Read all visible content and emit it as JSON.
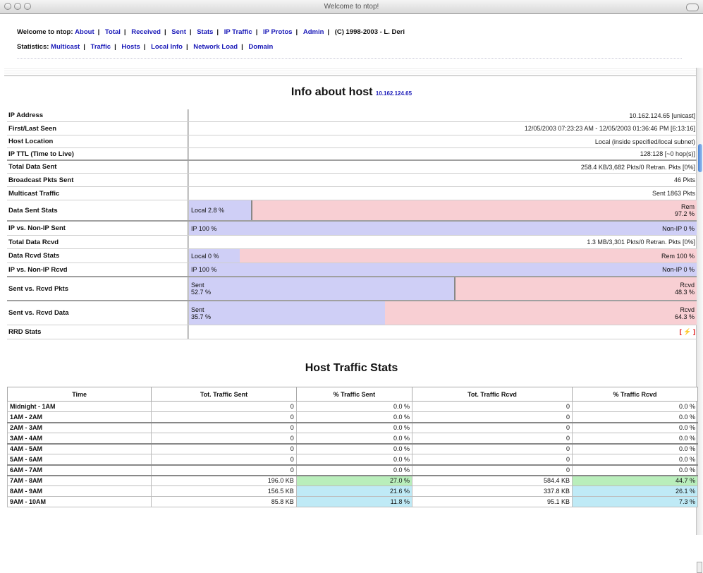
{
  "window": {
    "title": "Welcome to ntop!"
  },
  "nav1": {
    "intro": "Welcome to ntop:",
    "links": [
      "About",
      "Total",
      "Received",
      "Sent",
      "Stats",
      "IP Traffic",
      "IP Protos",
      "Admin"
    ],
    "copyright": "(C) 1998-2003 - L. Deri"
  },
  "nav2": {
    "intro": "Statistics:",
    "links": [
      "Multicast",
      "Traffic",
      "Hosts",
      "Local Info",
      "Network Load",
      "Domain"
    ]
  },
  "heading": {
    "title": "Info about host",
    "ip": "10.162.124.65"
  },
  "info": {
    "ip_address": {
      "label": "IP Address",
      "value": "10.162.124.65  [unicast]"
    },
    "first_last_seen": {
      "label": "First/Last Seen",
      "value": "12/05/2003 07:23:23 AM  -  12/05/2003 01:36:46 PM [6:13:16]"
    },
    "host_location": {
      "label": "Host Location",
      "value": "Local (inside specified/local subnet)"
    },
    "ip_ttl": {
      "label": "IP TTL (Time to Live)",
      "value": "128:128 [~0 hop(s)]"
    },
    "total_data_sent": {
      "label": "Total Data Sent",
      "value": "258.4 KB/3,682 Pkts/0 Retran. Pkts [0%]"
    },
    "broadcast_pkts": {
      "label": "Broadcast Pkts Sent",
      "value": "46 Pkts"
    },
    "multicast": {
      "label": "Multicast Traffic",
      "value": "Sent 1863 Pkts"
    },
    "data_sent_stats": {
      "label": "Data Sent Stats",
      "left": "Local 2.8 %",
      "right": "Rem\n97.2 %",
      "pct": 2.8
    },
    "ip_vs_nonip_sent": {
      "label": "IP vs. Non-IP Sent",
      "left": "IP 100 %",
      "right": "Non-IP 0 %",
      "pct": 100
    },
    "total_data_rcvd": {
      "label": "Total Data Rcvd",
      "value": "1.3 MB/3,301 Pkts/0 Retran. Pkts [0%]"
    },
    "data_rcvd_stats": {
      "label": "Data Rcvd Stats",
      "left": "Local 0 %",
      "right": "Rem 100 %",
      "pct": 0
    },
    "ip_vs_nonip_rcvd": {
      "label": "IP vs. Non-IP Rcvd",
      "left": "IP 100 %",
      "right": "Non-IP 0 %",
      "pct": 100
    },
    "sent_vs_rcvd_pkts": {
      "label": "Sent vs. Rcvd Pkts",
      "left": "Sent\n52.7 %",
      "right": "Rcvd\n48.3 %",
      "pct": 52.7
    },
    "sent_vs_rcvd_data": {
      "label": "Sent vs. Rcvd Data",
      "left": "Sent\n35.7 %",
      "right": "Rcvd\n64.3 %",
      "pct": 35.7
    },
    "rrd_stats": {
      "label": "RRD Stats",
      "value": "[ ⚡ ]"
    }
  },
  "traffic": {
    "title": "Host Traffic Stats",
    "headers": [
      "Time",
      "Tot. Traffic Sent",
      "% Traffic Sent",
      "Tot. Traffic Rcvd",
      "% Traffic Rcvd"
    ],
    "rows": [
      {
        "time": "Midnight - 1AM",
        "sent": "0",
        "psent": "0.0 %",
        "rcvd": "0",
        "prcvd": "0.0 %"
      },
      {
        "time": "1AM - 2AM",
        "sent": "0",
        "psent": "0.0 %",
        "rcvd": "0",
        "prcvd": "0.0 %"
      },
      {
        "time": "2AM - 3AM",
        "sent": "0",
        "psent": "0.0 %",
        "rcvd": "0",
        "prcvd": "0.0 %"
      },
      {
        "time": "3AM - 4AM",
        "sent": "0",
        "psent": "0.0 %",
        "rcvd": "0",
        "prcvd": "0.0 %"
      },
      {
        "time": "4AM - 5AM",
        "sent": "0",
        "psent": "0.0 %",
        "rcvd": "0",
        "prcvd": "0.0 %"
      },
      {
        "time": "5AM - 6AM",
        "sent": "0",
        "psent": "0.0 %",
        "rcvd": "0",
        "prcvd": "0.0 %"
      },
      {
        "time": "6AM - 7AM",
        "sent": "0",
        "psent": "0.0 %",
        "rcvd": "0",
        "prcvd": "0.0 %"
      },
      {
        "time": "7AM - 8AM",
        "sent": "196.0 KB",
        "psent": "27.0 %",
        "rcvd": "584.4 KB",
        "prcvd": "44.7 %"
      },
      {
        "time": "8AM - 9AM",
        "sent": "156.5 KB",
        "psent": "21.6 %",
        "rcvd": "337.8 KB",
        "prcvd": "26.1 %"
      },
      {
        "time": "9AM - 10AM",
        "sent": "85.8 KB",
        "psent": "11.8 %",
        "rcvd": "95.1 KB",
        "prcvd": "7.3 %"
      }
    ]
  }
}
